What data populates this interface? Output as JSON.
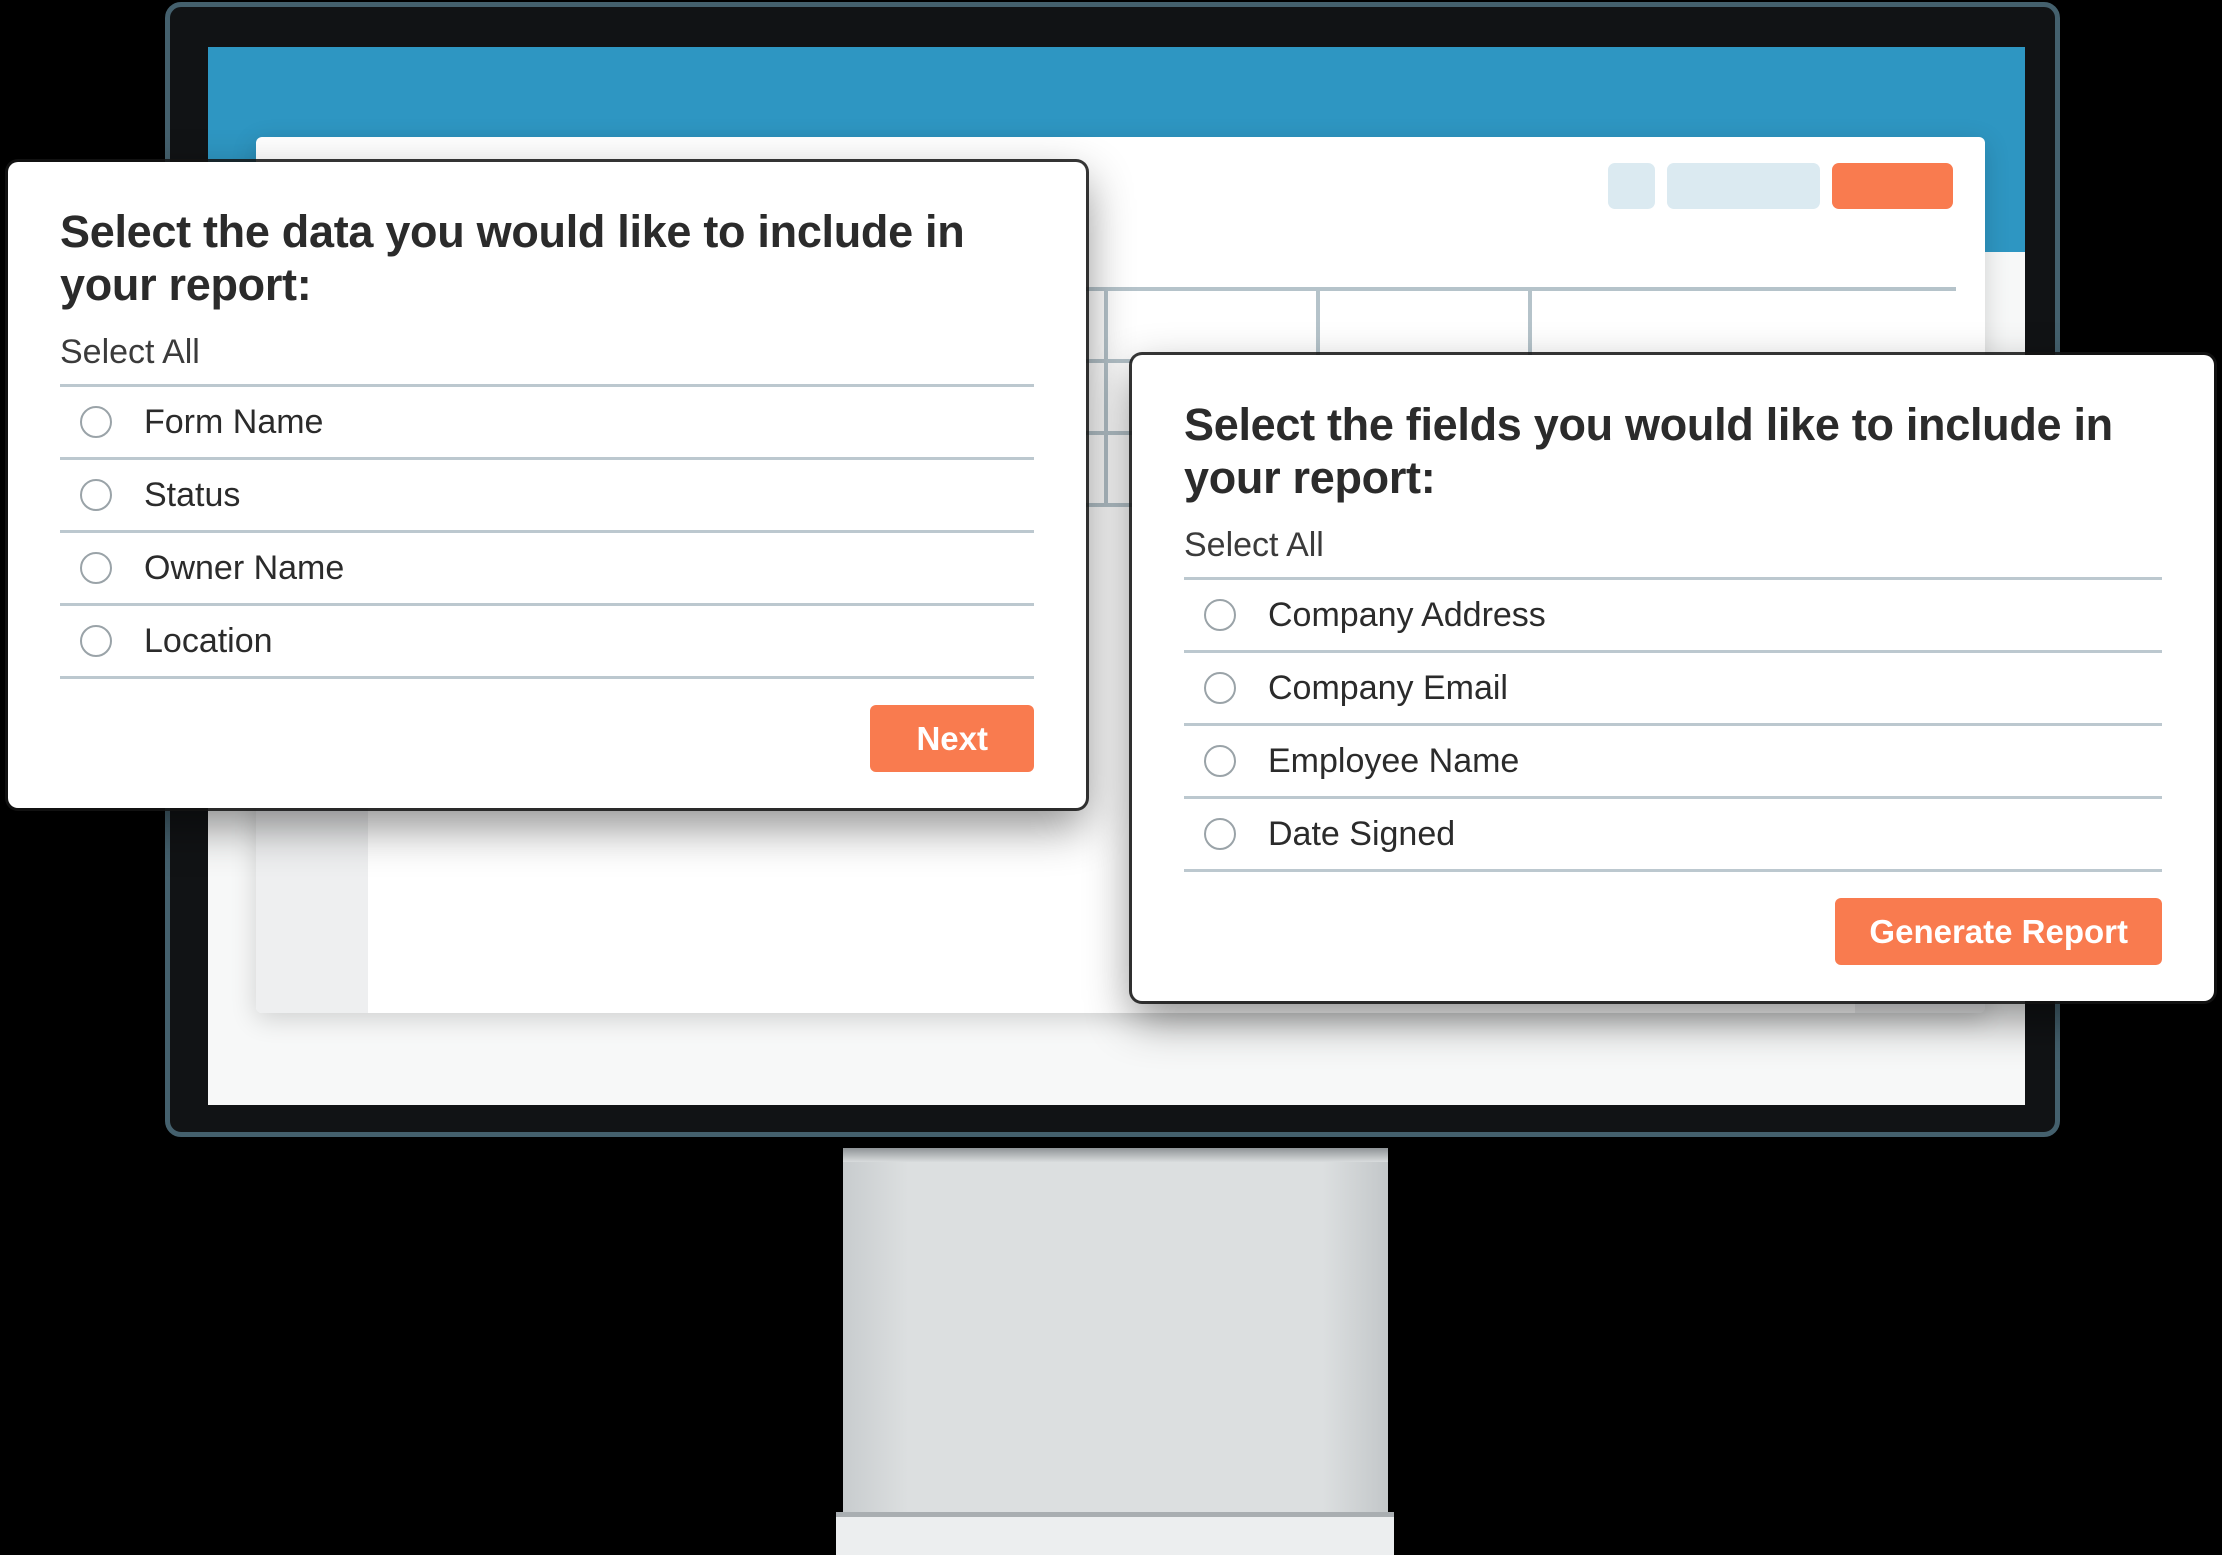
{
  "theme": {
    "accent_orange": "#f97b4f",
    "header_blue": "#2e96c2",
    "monitor_bezel": "#44606d",
    "monitor_body": "#111315",
    "grid_line": "#b5c3ca",
    "chip_blue": "#dbeaf1",
    "panel_gray": "#eeeff0"
  },
  "device": {
    "name": "desktop-monitor",
    "stand": "monitor-stand"
  },
  "app": {
    "header_band": "",
    "toolbar": {
      "chips": [
        {
          "name": "toolbar-icon-button",
          "style": "small"
        },
        {
          "name": "toolbar-search-field",
          "style": "wide"
        },
        {
          "name": "toolbar-primary-button",
          "style": "accent"
        }
      ]
    },
    "grid": {
      "rows": 3,
      "columns": 5
    }
  },
  "dialog_data": {
    "title": "Select the data you would like to include in your report:",
    "select_all_label": "Select All",
    "options": [
      {
        "label": "Form Name",
        "selected": false
      },
      {
        "label": "Status",
        "selected": false
      },
      {
        "label": "Owner Name",
        "selected": false
      },
      {
        "label": "Location",
        "selected": false
      }
    ],
    "primary_button": "Next"
  },
  "dialog_fields": {
    "title": "Select the fields you would like to include in your report:",
    "select_all_label": "Select All",
    "options": [
      {
        "label": "Company Address",
        "selected": false
      },
      {
        "label": "Company Email",
        "selected": false
      },
      {
        "label": "Employee Name",
        "selected": false
      },
      {
        "label": "Date Signed",
        "selected": false
      }
    ],
    "primary_button": "Generate Report"
  }
}
